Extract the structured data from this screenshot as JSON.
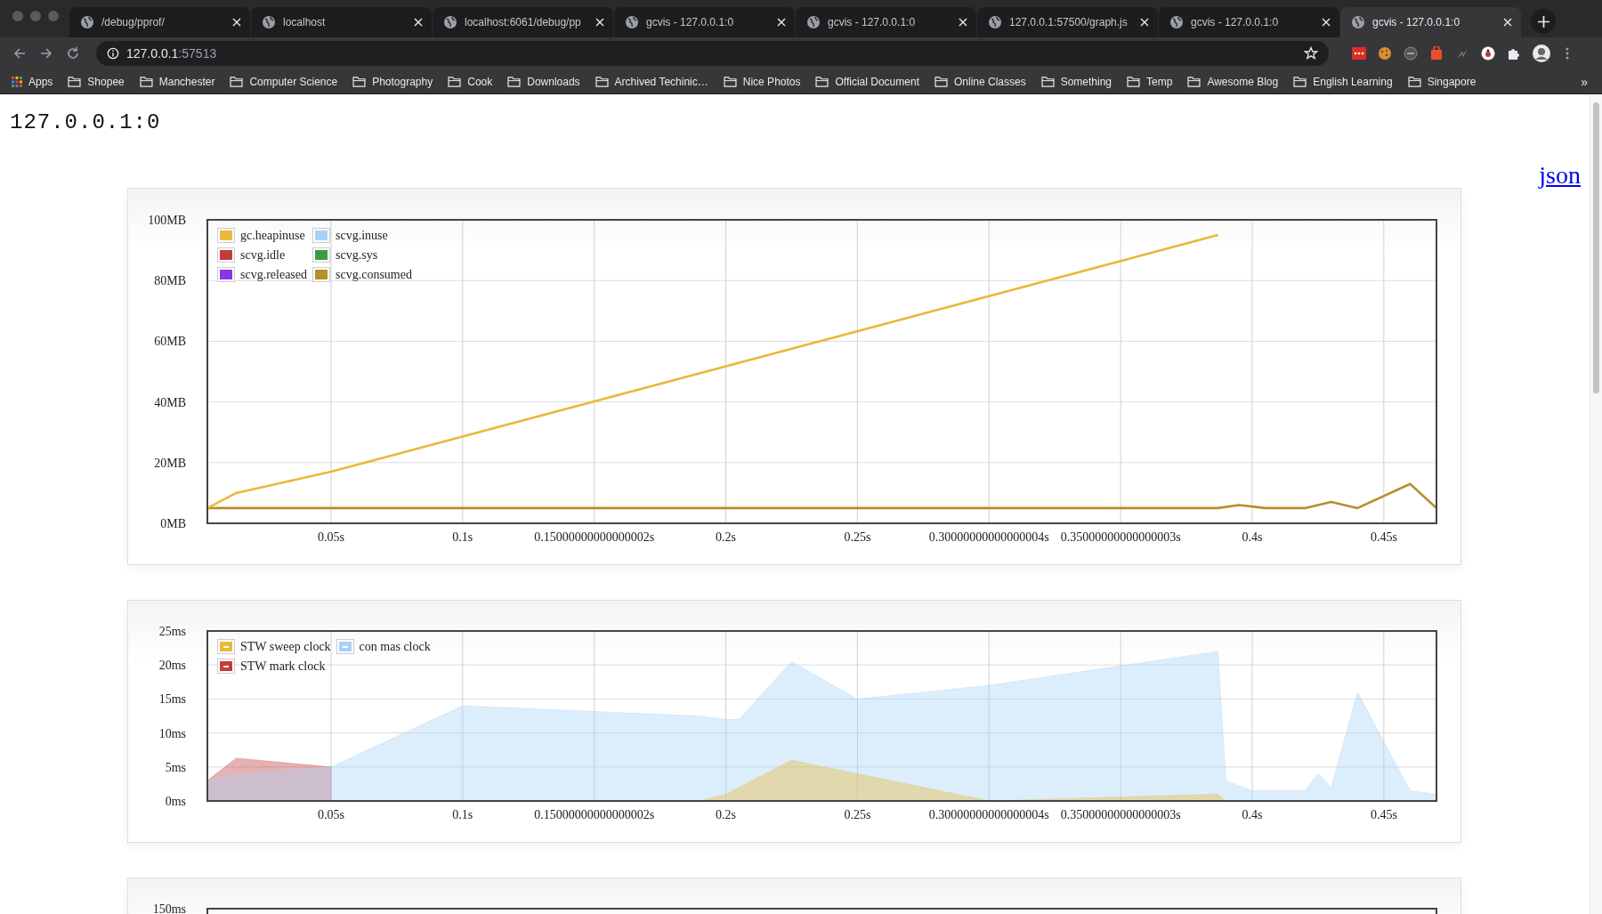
{
  "tabs": [
    {
      "title": "/debug/pprof/",
      "selected": false
    },
    {
      "title": "localhost",
      "selected": false
    },
    {
      "title": "localhost:6061/debug/pp",
      "selected": false
    },
    {
      "title": "gcvis - 127.0.0.1:0",
      "selected": false
    },
    {
      "title": "gcvis - 127.0.0.1:0",
      "selected": false
    },
    {
      "title": "127.0.0.1:57500/graph.js",
      "selected": false
    },
    {
      "title": "gcvis - 127.0.0.1:0",
      "selected": false
    },
    {
      "title": "gcvis - 127.0.0.1:0",
      "selected": true
    }
  ],
  "toolbar": {
    "address": {
      "host": "127.0.0.1",
      "port": ":57513"
    }
  },
  "bookmarks": {
    "apps": "Apps",
    "folders": [
      "Shopee",
      "Manchester",
      "Computer Science",
      "Photography",
      "Cook",
      "Downloads",
      "Archived Techinic…",
      "Nice Photos",
      "Official Document",
      "Online Classes",
      "Something",
      "Temp",
      "Awesome Blog",
      "English Learning",
      "Singapore"
    ],
    "overflow": "»"
  },
  "page": {
    "heading": "127.0.0.1:0",
    "json_link": "json",
    "charts": [
      {
        "chart_data": {
          "type": "line",
          "grid": true,
          "legend": "upper left",
          "xlim": [
            0.003,
            0.47
          ],
          "ylim": [
            0,
            100
          ],
          "xticks": [
            {
              "value": 0.05,
              "label": "0.05s"
            },
            {
              "value": 0.1,
              "label": "0.1s"
            },
            {
              "value": 0.15,
              "label": "0.15000000000000002s"
            },
            {
              "value": 0.2,
              "label": "0.2s"
            },
            {
              "value": 0.25,
              "label": "0.25s"
            },
            {
              "value": 0.3,
              "label": "0.30000000000000004s"
            },
            {
              "value": 0.35,
              "label": "0.35000000000000003s"
            },
            {
              "value": 0.4,
              "label": "0.4s"
            },
            {
              "value": 0.45,
              "label": "0.45s"
            }
          ],
          "yticks": [
            {
              "value": 100,
              "label": "100MB"
            },
            {
              "value": 80,
              "label": "80MB"
            },
            {
              "value": 60,
              "label": "60MB"
            },
            {
              "value": 40,
              "label": "40MB"
            },
            {
              "value": 20,
              "label": "20MB"
            },
            {
              "value": 0,
              "label": "0MB"
            }
          ],
          "x": [
            0.003,
            0.014,
            0.05,
            0.387,
            0.395,
            0.405,
            0.42,
            0.43,
            0.44,
            0.46,
            0.47
          ],
          "series": [
            {
              "name": "gc.heapinuse",
              "color": "#e9b93a",
              "values": [
                5,
                10,
                17,
                95,
                null,
                null,
                null,
                null,
                null,
                null,
                null
              ]
            },
            {
              "name": "scvg.inuse",
              "color": "#a8d1f7",
              "values": [
                null,
                null,
                null,
                null,
                null,
                null,
                null,
                null,
                null,
                null,
                null
              ]
            },
            {
              "name": "scvg.idle",
              "color": "#c43b3b",
              "values": [
                null,
                null,
                null,
                null,
                null,
                null,
                null,
                null,
                null,
                null,
                null
              ]
            },
            {
              "name": "scvg.sys",
              "color": "#3e9a46",
              "values": [
                null,
                null,
                null,
                null,
                null,
                null,
                null,
                null,
                null,
                null,
                null
              ]
            },
            {
              "name": "scvg.released",
              "color": "#8a35e8",
              "values": [
                null,
                null,
                null,
                null,
                null,
                null,
                null,
                null,
                null,
                null,
                null
              ]
            },
            {
              "name": "scvg.consumed",
              "color": "#b58f2a",
              "values": [
                5,
                5,
                5,
                5,
                6,
                5,
                5,
                7,
                5,
                13,
                5
              ]
            }
          ]
        }
      },
      {
        "chart_data": {
          "type": "area",
          "grid": true,
          "legend": "upper left",
          "xlim": [
            0.003,
            0.47
          ],
          "ylim": [
            0,
            25
          ],
          "xticks": [
            {
              "value": 0.05,
              "label": "0.05s"
            },
            {
              "value": 0.1,
              "label": "0.1s"
            },
            {
              "value": 0.15,
              "label": "0.15000000000000002s"
            },
            {
              "value": 0.2,
              "label": "0.2s"
            },
            {
              "value": 0.25,
              "label": "0.25s"
            },
            {
              "value": 0.3,
              "label": "0.30000000000000004s"
            },
            {
              "value": 0.35,
              "label": "0.35000000000000003s"
            },
            {
              "value": 0.4,
              "label": "0.4s"
            },
            {
              "value": 0.45,
              "label": "0.45s"
            }
          ],
          "yticks": [
            {
              "value": 25,
              "label": "25ms"
            },
            {
              "value": 20,
              "label": "20ms"
            },
            {
              "value": 15,
              "label": "15ms"
            },
            {
              "value": 10,
              "label": "10ms"
            },
            {
              "value": 5,
              "label": "5ms"
            },
            {
              "value": 0,
              "label": "0ms"
            }
          ],
          "x": [
            0.003,
            0.014,
            0.05,
            0.1,
            0.19,
            0.2,
            0.205,
            0.225,
            0.25,
            0.3,
            0.387,
            0.39,
            0.4,
            0.42,
            0.425,
            0.43,
            0.44,
            0.46,
            0.47
          ],
          "series": [
            {
              "name": "STW sweep clock",
              "color": "#e9b93a",
              "values": [
                0,
                0,
                0,
                0,
                0,
                1,
                2,
                6,
                4,
                0,
                1,
                0,
                0,
                0,
                0,
                0,
                0,
                0,
                0
              ]
            },
            {
              "name": "con mas clock",
              "color": "#a8d1f7",
              "values": [
                3,
                4,
                5,
                14,
                12.5,
                12,
                12,
                20.5,
                15,
                17,
                22,
                3,
                1.5,
                1.5,
                4,
                2,
                16,
                1.5,
                1
              ]
            },
            {
              "name": "STW mark clock",
              "color": "#c43b3b",
              "values": [
                3,
                6.3,
                5,
                null,
                null,
                null,
                null,
                null,
                null,
                null,
                null,
                null,
                null,
                null,
                null,
                null,
                null,
                null,
                null
              ]
            }
          ]
        }
      }
    ],
    "partial_chart": {
      "top_tick": "150ms"
    }
  }
}
